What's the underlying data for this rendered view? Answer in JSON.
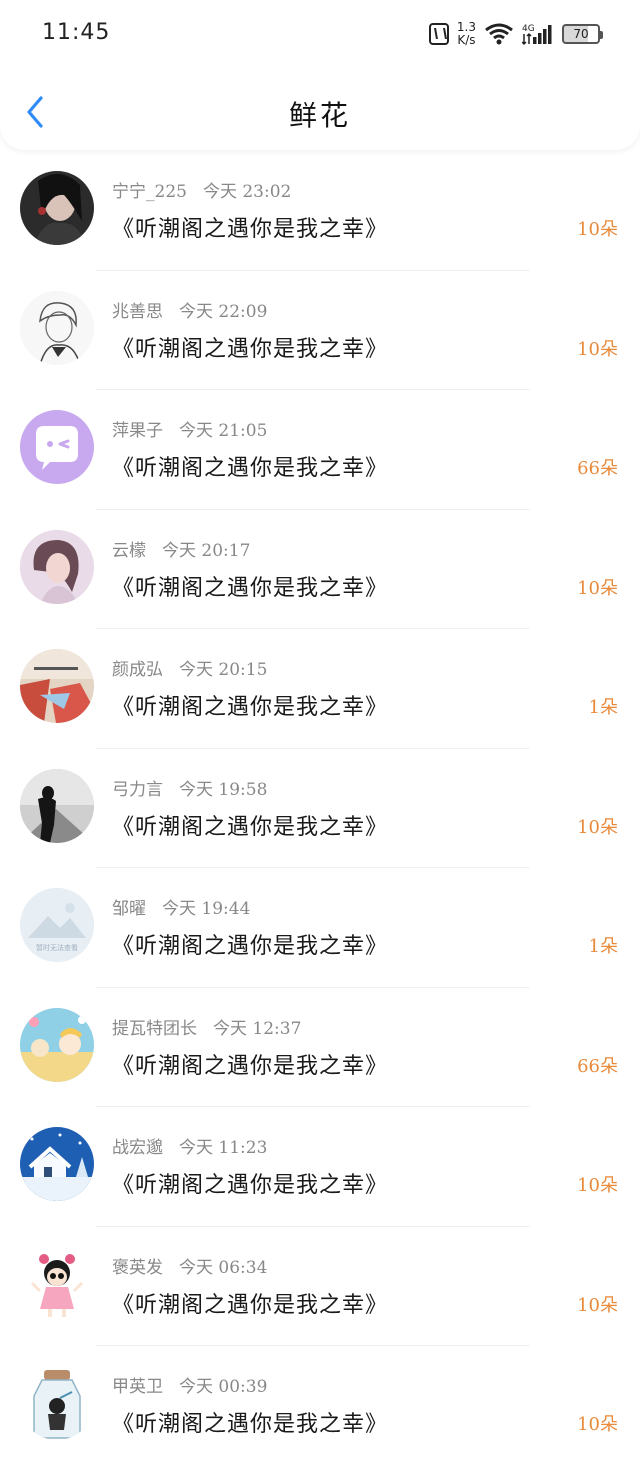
{
  "status_bar": {
    "time": "11:45",
    "net_speed_value": "1.3",
    "net_speed_unit": "K/s",
    "network_type": "4G",
    "battery": "70",
    "icons": [
      "nfc-icon",
      "wifi-icon",
      "signal-icon",
      "battery-icon"
    ]
  },
  "header": {
    "title": "鲜花",
    "back_icon": "chevron-left-icon",
    "accent_color": "#2f8bf5"
  },
  "list_colors": {
    "count": "#e98a3b",
    "meta": "#888888"
  },
  "items": [
    {
      "name": "宁宁_225",
      "time": "今天 23:02",
      "book": "《听潮阁之遇你是我之幸》",
      "count": "10朵",
      "avatar": "dark-portrait"
    },
    {
      "name": "兆善思",
      "time": "今天 22:09",
      "book": "《听潮阁之遇你是我之幸》",
      "count": "10朵",
      "avatar": "sketch-character"
    },
    {
      "name": "萍果子",
      "time": "今天 21:05",
      "book": "《听潮阁之遇你是我之幸》",
      "count": "66朵",
      "avatar": "purple-chat-bubble"
    },
    {
      "name": "云檬",
      "time": "今天 20:17",
      "book": "《听潮阁之遇你是我之幸》",
      "count": "10朵",
      "avatar": "soft-portrait"
    },
    {
      "name": "颜成弘",
      "time": "今天 20:15",
      "book": "《听潮阁之遇你是我之幸》",
      "count": "1朵",
      "avatar": "red-abstract"
    },
    {
      "name": "弓力言",
      "time": "今天 19:58",
      "book": "《听潮阁之遇你是我之幸》",
      "count": "10朵",
      "avatar": "grayscale-figure"
    },
    {
      "name": "邹曜",
      "time": "今天 19:44",
      "book": "《听潮阁之遇你是我之幸》",
      "count": "1朵",
      "avatar": "placeholder-image"
    },
    {
      "name": "提瓦特团长",
      "time": "今天 12:37",
      "book": "《听潮阁之遇你是我之幸》",
      "count": "66朵",
      "avatar": "anime-illustration"
    },
    {
      "name": "战宏邈",
      "time": "今天 11:23",
      "book": "《听潮阁之遇你是我之幸》",
      "count": "10朵",
      "avatar": "snow-house"
    },
    {
      "name": "褒英发",
      "time": "今天 06:34",
      "book": "《听潮阁之遇你是我之幸》",
      "count": "10朵",
      "avatar": "cartoon-girl"
    },
    {
      "name": "甲英卫",
      "time": "今天 00:39",
      "book": "《听潮阁之遇你是我之幸》",
      "count": "10朵",
      "avatar": "bottle-character"
    }
  ],
  "placeholder_avatar_caption": "暂时无法查看"
}
